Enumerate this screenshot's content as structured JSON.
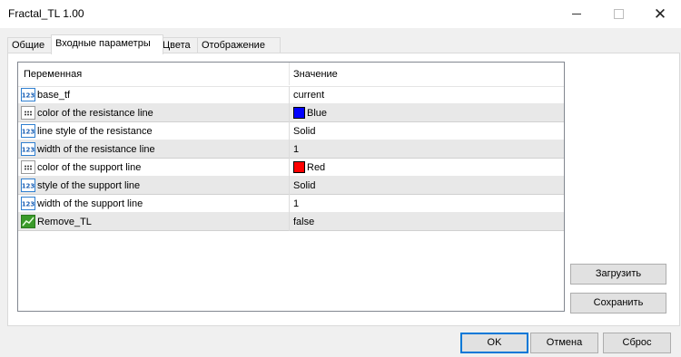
{
  "window": {
    "title": "Fractal_TL 1.00"
  },
  "tabs": [
    {
      "label": "Общие"
    },
    {
      "label": "Входные параметры"
    },
    {
      "label": "Цвета"
    },
    {
      "label": "Отображение"
    }
  ],
  "grid": {
    "col_variable": "Переменная",
    "col_value": "Значение",
    "rows": [
      {
        "icon": "numeric-123-icon",
        "name": "base_tf",
        "value": "current"
      },
      {
        "icon": "color-dots-icon",
        "name": "color of the resistance line",
        "value": "Blue",
        "color": "#0000ff"
      },
      {
        "icon": "numeric-123-icon",
        "name": "line style of the resistance",
        "value": "Solid"
      },
      {
        "icon": "numeric-123-icon",
        "name": "width of the resistance line",
        "value": "1"
      },
      {
        "icon": "color-dots-icon",
        "name": "color of the support line",
        "value": "Red",
        "color": "#ff0000"
      },
      {
        "icon": "numeric-123-icon",
        "name": "style of the support line",
        "value": "Solid"
      },
      {
        "icon": "numeric-123-icon",
        "name": "width of the support line",
        "value": "1"
      },
      {
        "icon": "boolean-chart-icon",
        "name": "Remove_TL",
        "value": "false"
      }
    ]
  },
  "side_buttons": {
    "load": "Загрузить",
    "save": "Сохранить"
  },
  "footer": {
    "ok": "OK",
    "cancel": "Отмена",
    "reset": "Сброс"
  }
}
